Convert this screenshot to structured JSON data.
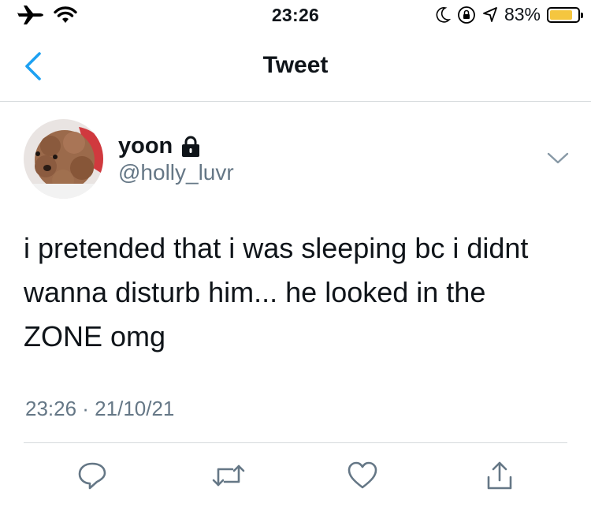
{
  "status_bar": {
    "time": "23:26",
    "battery_percent_label": "83%",
    "battery_level": 0.83,
    "icons": [
      "airplane-icon",
      "wifi-icon",
      "moon-icon",
      "orientation-lock-icon",
      "location-icon",
      "battery-icon"
    ],
    "battery_color": "#f5c63f"
  },
  "nav": {
    "title": "Tweet",
    "back_icon": "chevron-left-icon",
    "accent_color": "#1da1f2"
  },
  "tweet": {
    "display_name": "yoon",
    "protected_icon": "lock-icon",
    "handle": "@holly_luvr",
    "text": "i pretended that i was sleeping bc i didnt wanna disturb him... he looked in the ZONE omg",
    "timestamp": "23:26 · 21/10/21",
    "menu_icon": "chevron-down-icon"
  },
  "actions": [
    {
      "name": "reply",
      "icon": "reply-icon"
    },
    {
      "name": "retweet",
      "icon": "retweet-icon"
    },
    {
      "name": "like",
      "icon": "heart-icon"
    },
    {
      "name": "share",
      "icon": "share-icon"
    }
  ],
  "colors": {
    "secondary_text": "#657786",
    "divider": "#d5d9dc",
    "action_icon": "#657786"
  }
}
